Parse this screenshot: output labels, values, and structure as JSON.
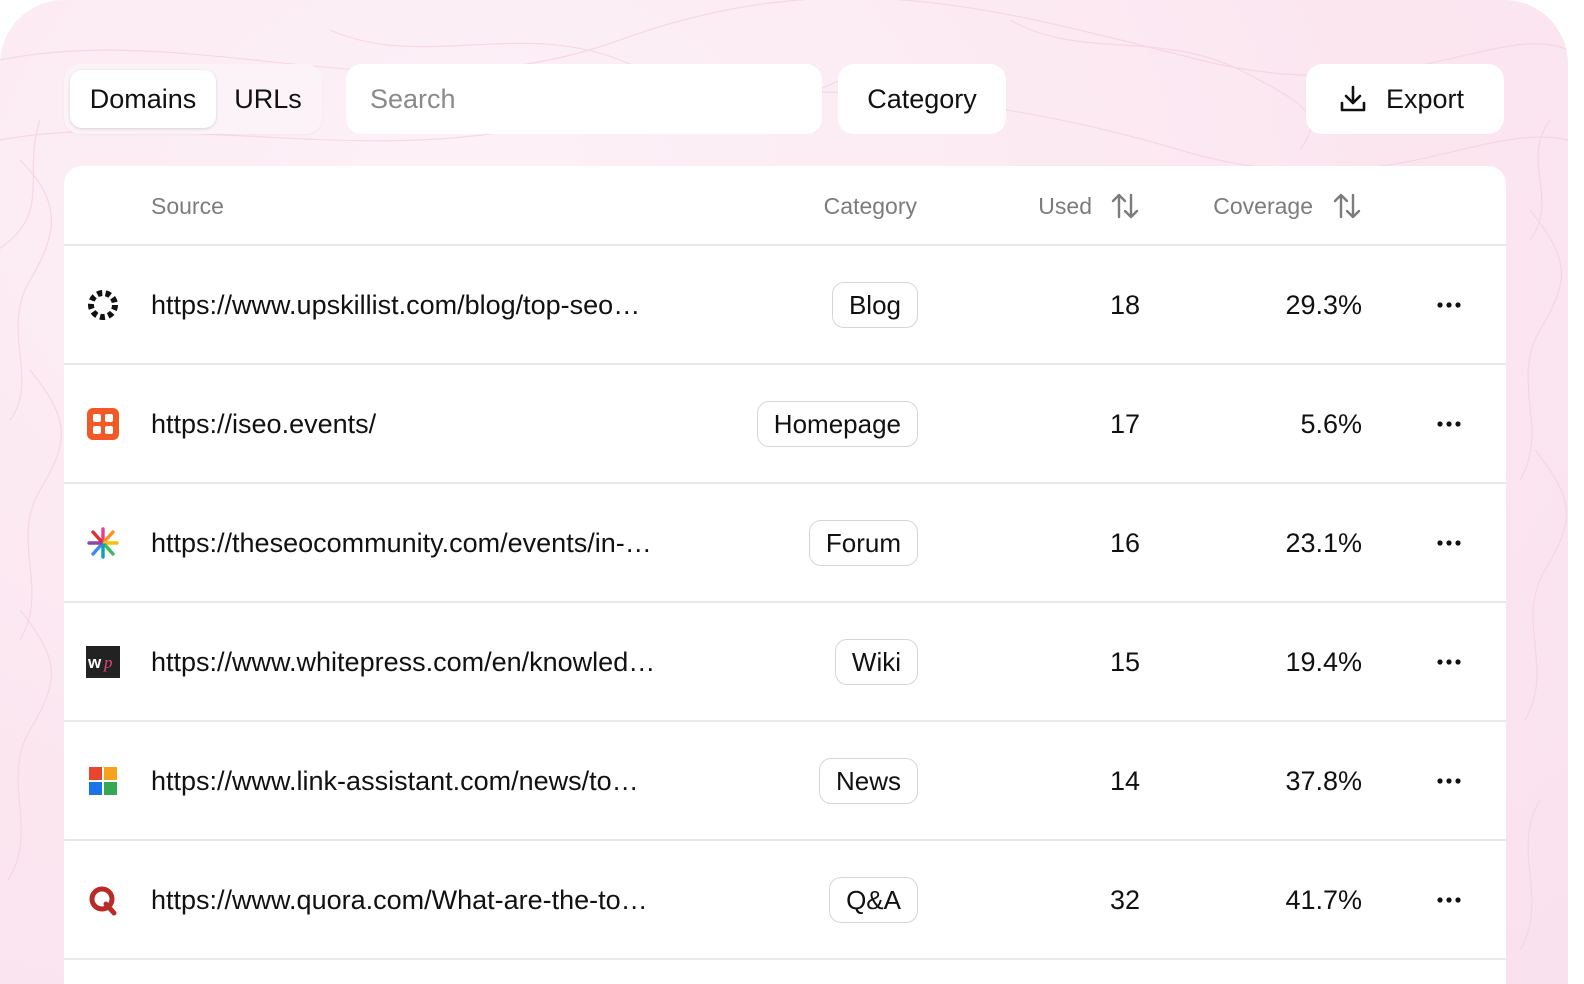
{
  "toggle": {
    "domains": "Domains",
    "urls": "URLs"
  },
  "search": {
    "placeholder": "Search"
  },
  "filters": {
    "category": "Category",
    "export": "Export"
  },
  "table": {
    "headers": {
      "source": "Source",
      "category": "Category",
      "used": "Used",
      "coverage": "Coverage"
    },
    "rows": [
      {
        "url": "https://www.upskillist.com/blog/top-seo…",
        "category": "Blog",
        "used": "18",
        "coverage": "29.3%",
        "icon": "upskillist-favicon"
      },
      {
        "url": "https://iseo.events/",
        "category": "Homepage",
        "used": "17",
        "coverage": "5.6%",
        "icon": "iseo-favicon"
      },
      {
        "url": "https://theseocommunity.com/events/in-…",
        "category": "Forum",
        "used": "16",
        "coverage": "23.1%",
        "icon": "theseocommunity-favicon"
      },
      {
        "url": "https://www.whitepress.com/en/knowled…",
        "category": "Wiki",
        "used": "15",
        "coverage": "19.4%",
        "icon": "whitepress-favicon"
      },
      {
        "url": "https://www.link-assistant.com/news/to…",
        "category": "News",
        "used": "14",
        "coverage": "37.8%",
        "icon": "link-assistant-favicon"
      },
      {
        "url": "https://www.quora.com/What-are-the-to…",
        "category": "Q&A",
        "used": "32",
        "coverage": "41.7%",
        "icon": "quora-favicon"
      }
    ]
  },
  "colors": {
    "background": "#fbe6f0",
    "text": "#111111",
    "muted": "#7c7c7c",
    "border": "#e9e9e9"
  }
}
